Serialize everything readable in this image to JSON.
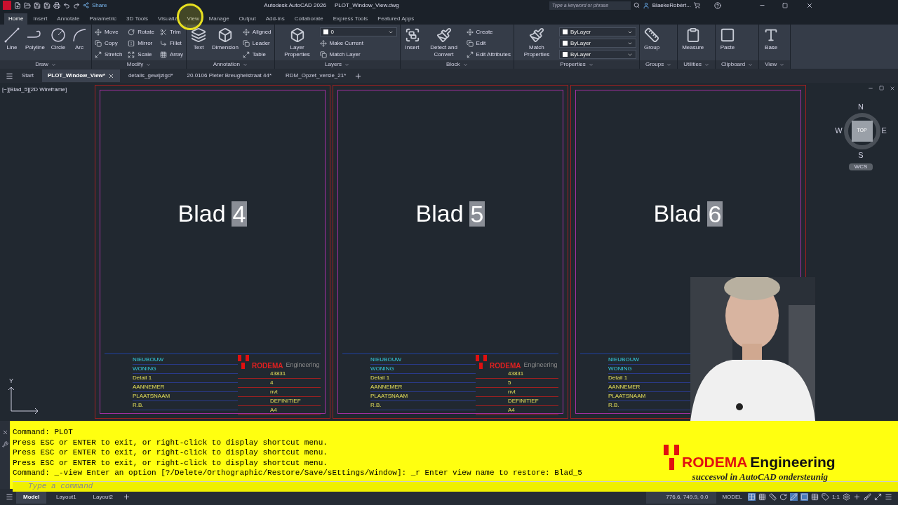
{
  "title_bar": {
    "app_title": "Autodesk AutoCAD 2026",
    "file_name": "PLOT_Window_View.dwg",
    "share": "Share",
    "search_placeholder": "Type a keyword or phrase",
    "user": "BlaekeRobèrt..."
  },
  "ribbon_tabs": [
    {
      "label": "Home",
      "selected": true
    },
    {
      "label": "Insert",
      "selected": false
    },
    {
      "label": "Annotate",
      "selected": false
    },
    {
      "label": "Parametric",
      "selected": false
    },
    {
      "label": "3D Tools",
      "selected": false
    },
    {
      "label": "Visualiz",
      "selected": false
    },
    {
      "label": "View",
      "selected": false
    },
    {
      "label": "Manage",
      "selected": false
    },
    {
      "label": "Output",
      "selected": false
    },
    {
      "label": "Add-ins",
      "selected": false
    },
    {
      "label": "Collaborate",
      "selected": false
    },
    {
      "label": "Express Tools",
      "selected": false
    },
    {
      "label": "Featured Apps",
      "selected": false
    }
  ],
  "ribbon_panels": [
    {
      "title": "Draw",
      "tools": [
        {
          "kind": "large",
          "label": "Line"
        },
        {
          "kind": "large",
          "label": "Polyline"
        },
        {
          "kind": "large",
          "label": "Circle"
        },
        {
          "kind": "large",
          "label": "Arc"
        }
      ]
    },
    {
      "title": "Modify",
      "tools": [
        {
          "kind": "small",
          "label": "Move"
        },
        {
          "kind": "small",
          "label": "Copy"
        },
        {
          "kind": "small",
          "label": "Stretch"
        },
        {
          "kind": "small",
          "label": "Rotate"
        },
        {
          "kind": "small",
          "label": "Mirror"
        },
        {
          "kind": "small",
          "label": "Scale"
        },
        {
          "kind": "small",
          "label": "Trim"
        },
        {
          "kind": "small",
          "label": "Fillet"
        },
        {
          "kind": "small",
          "label": "Array"
        }
      ]
    },
    {
      "title": "Annotation",
      "tools": [
        {
          "kind": "large",
          "label": "Text"
        },
        {
          "kind": "large",
          "label": "Dimension"
        },
        {
          "kind": "small",
          "label": "Aligned"
        },
        {
          "kind": "small",
          "label": "Leader"
        },
        {
          "kind": "small",
          "label": "Table"
        }
      ]
    },
    {
      "title": "Layers",
      "tools": [
        {
          "kind": "large",
          "label": "Layer Properties"
        },
        {
          "kind": "dropdown",
          "label": "0"
        },
        {
          "kind": "small",
          "label": "Make Current"
        },
        {
          "kind": "small",
          "label": "Match Layer"
        }
      ]
    },
    {
      "title": "Block",
      "tools": [
        {
          "kind": "large",
          "label": "Insert"
        },
        {
          "kind": "large",
          "label": "Detect and Convert"
        },
        {
          "kind": "small",
          "label": "Create"
        },
        {
          "kind": "small",
          "label": "Edit"
        },
        {
          "kind": "small",
          "label": "Edit Attributes"
        }
      ]
    },
    {
      "title": "Properties",
      "tools": [
        {
          "kind": "large",
          "label": "Match Properties"
        },
        {
          "kind": "dropdown",
          "label": "ByLayer"
        },
        {
          "kind": "dropdown",
          "label": "ByLayer"
        },
        {
          "kind": "dropdown",
          "label": "ByLayer"
        }
      ]
    },
    {
      "title": "Groups",
      "tools": [
        {
          "kind": "large",
          "label": "Group"
        }
      ]
    },
    {
      "title": "Utilities",
      "tools": [
        {
          "kind": "large",
          "label": "Measure"
        }
      ]
    },
    {
      "title": "Clipboard",
      "tools": [
        {
          "kind": "large",
          "label": "Paste"
        }
      ]
    },
    {
      "title": "View",
      "tools": [
        {
          "kind": "large",
          "label": "Base"
        }
      ]
    }
  ],
  "file_tabs": [
    {
      "label": "Start",
      "selected": false
    },
    {
      "label": "PLOT_Window_View*",
      "selected": true
    },
    {
      "label": "details_gewijzigd*",
      "selected": false
    },
    {
      "label": "20.0106 Pieter Breughelstraat 44*",
      "selected": false
    },
    {
      "label": "RDM_Opzet_versie_21*",
      "selected": false
    }
  ],
  "viewport": {
    "label": "[−][Blad_5][2D Wireframe]",
    "sheets": [
      {
        "title": "Blad",
        "number": "4",
        "rows": [
          "NIEUBOUW",
          "WONING",
          "Detail 1",
          "AANNEMER",
          "PLAATSNAAM",
          "R.B."
        ],
        "logo": "RODEMA",
        "logo_sub": "Engineering",
        "values": [
          "43831",
          "4",
          "nvt",
          "DEFINITIEF",
          "A4"
        ]
      },
      {
        "title": "Blad",
        "number": "5",
        "rows": [
          "NIEUBOUW",
          "WONING",
          "Detail 1",
          "AANNEMER",
          "PLAATSNAAM",
          "R.B."
        ],
        "logo": "RODEMA",
        "logo_sub": "Engineering",
        "values": [
          "43831",
          "5",
          "nvt",
          "DEFINITIEF",
          "A4"
        ]
      },
      {
        "title": "Blad",
        "number": "6",
        "rows": [
          "NIEUBOUW",
          "WONING",
          "Detail 1",
          "AANNEMER",
          "PLAATSNAAM",
          "R.B."
        ]
      }
    ],
    "viewcube": {
      "north": "N",
      "south": "S",
      "east": "E",
      "west": "W",
      "face": "TOP",
      "ucs": "WCS"
    },
    "axis": {
      "y": "Y"
    }
  },
  "command_line": {
    "history": [
      "Command: PLOT",
      "Press ESC or ENTER to exit, or right-click to display shortcut menu.",
      "Press ESC or ENTER to exit, or right-click to display shortcut menu.",
      "Press ESC or ENTER to exit, or right-click to display shortcut menu.",
      "Command: _-view Enter an option [?/Delete/Orthographic/Restore/Save/sEttings/Window]: _r Enter view name to restore: Blad_5"
    ],
    "placeholder": "Type a command"
  },
  "branding": {
    "name": "RODEMA",
    "sub": "Engineering",
    "slogan": "succesvol in AutoCAD ondersteunig"
  },
  "layout_tabs": [
    {
      "label": "Model",
      "selected": true
    },
    {
      "label": "Layout1",
      "selected": false
    },
    {
      "label": "Layout2",
      "selected": false
    }
  ],
  "status_bar": {
    "coordinates": "776.6, 749.9, 0.0",
    "space": "MODEL",
    "scale": "1:1"
  }
}
